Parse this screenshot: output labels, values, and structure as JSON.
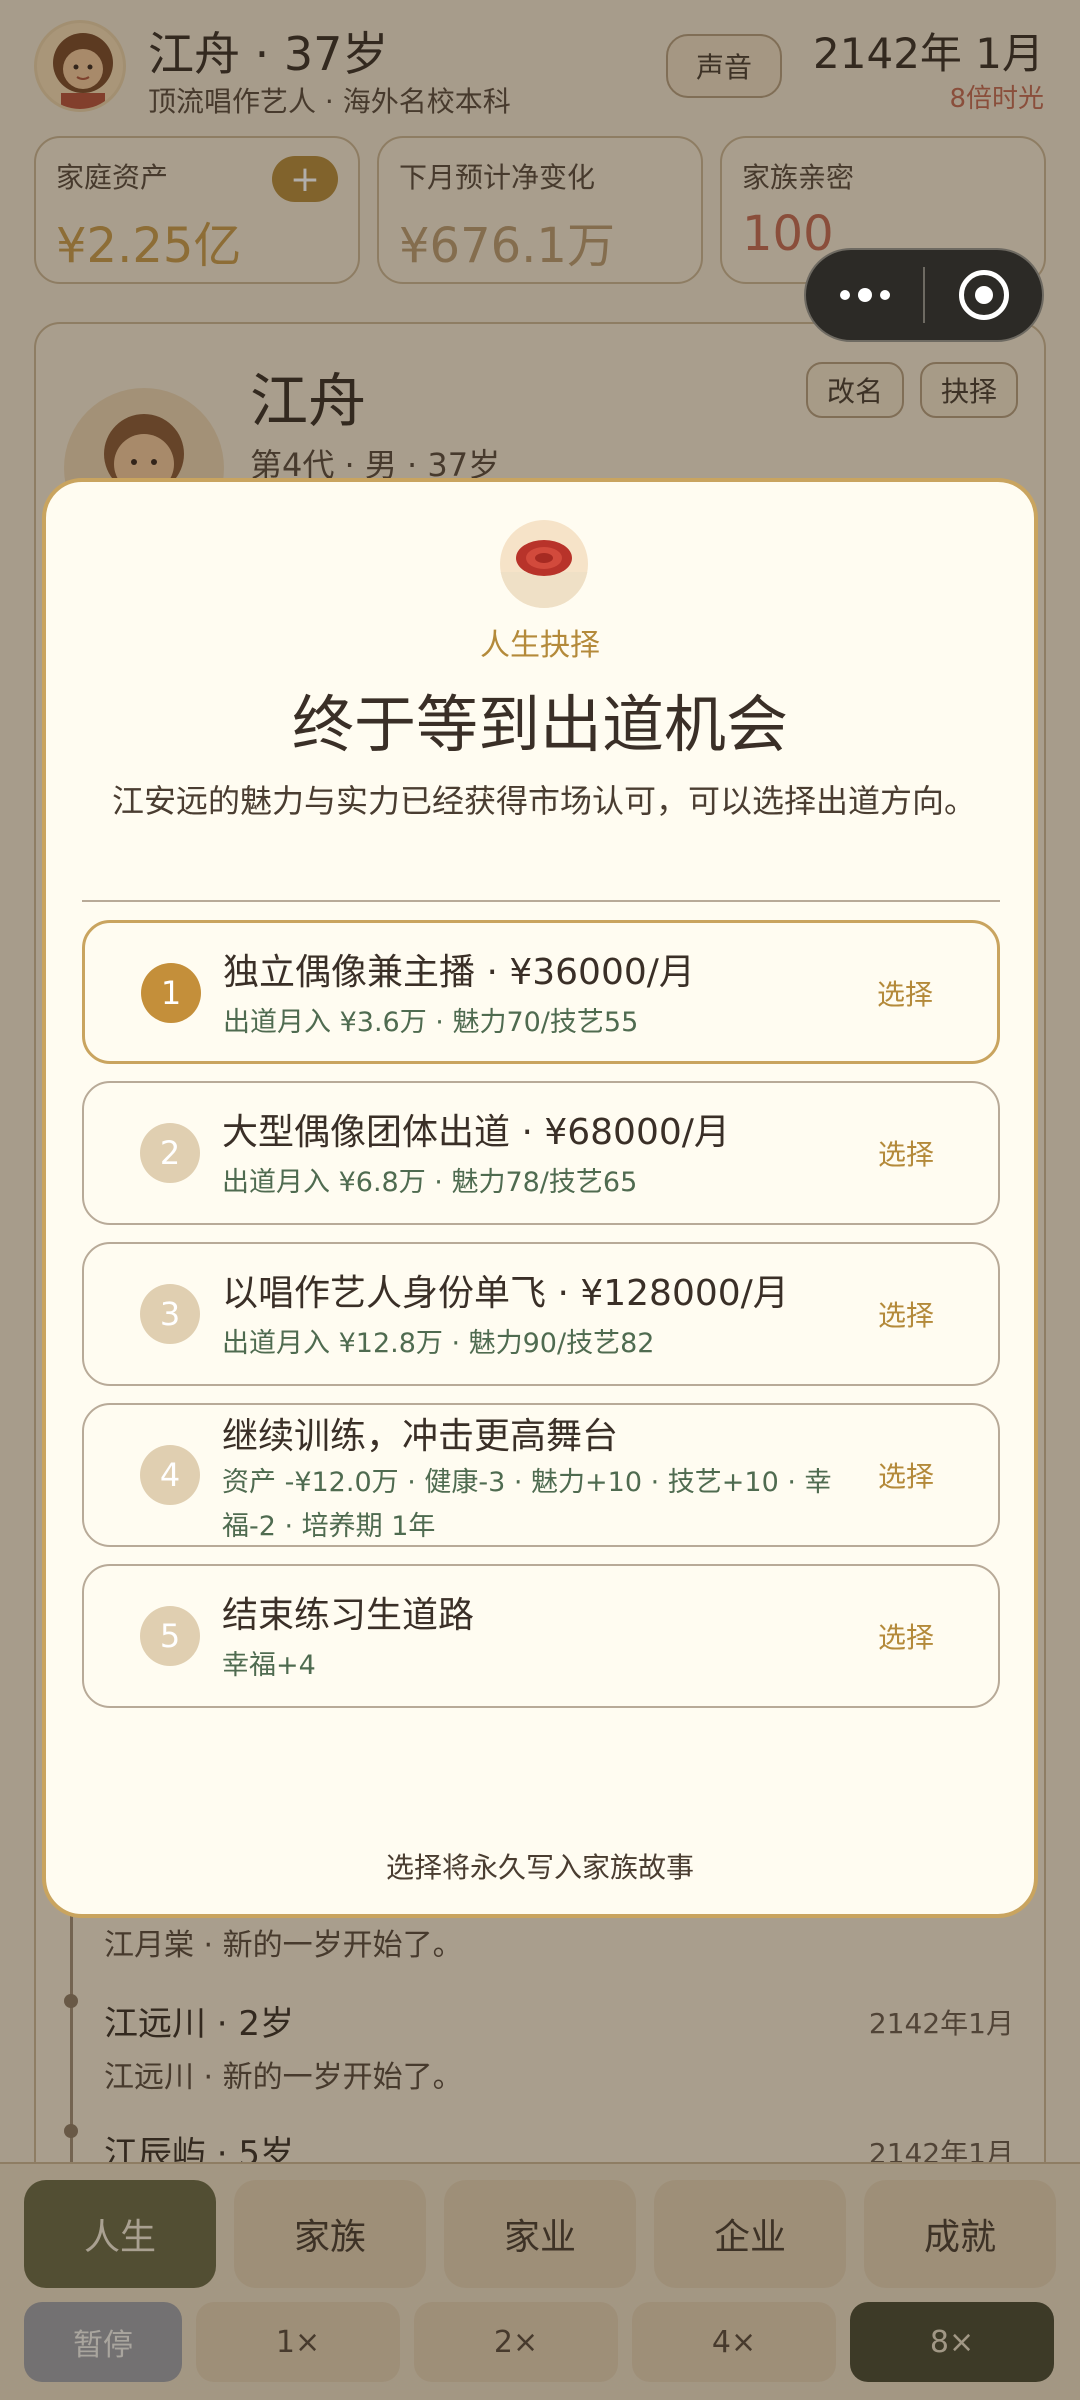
{
  "header": {
    "name_age": "江舟 · 37岁",
    "subtitle": "顶流唱作艺人 · 海外名校本科",
    "sound_label": "声音",
    "date": "2142年 1月",
    "speed_text": "8倍时光"
  },
  "stats": [
    {
      "label": "家庭资产",
      "value": "¥2.25亿",
      "color": "#c79a4a"
    },
    {
      "label": "下月预计净变化",
      "value": "¥676.1万",
      "color": "#b99a70"
    },
    {
      "label": "家族亲密",
      "value": "100",
      "color": "#c26a52"
    }
  ],
  "add_button": "+",
  "profile": {
    "name": "江舟",
    "meta": "第4代 · 男 · 37岁",
    "rename_label": "改名",
    "choose_label": "抉择"
  },
  "log": [
    {
      "title": "",
      "text": "江月棠 · 新的一岁开始了。",
      "time": ""
    },
    {
      "title": "江远川 · 2岁",
      "text": "江远川 · 新的一岁开始了。",
      "time": "2142年1月"
    },
    {
      "title": "江辰屿 · 5岁",
      "text": "",
      "time": "2142年1月"
    }
  ],
  "modal": {
    "kicker": "人生抉择",
    "title": "终于等到出道机会",
    "description": "江安远的魅力与实力已经获得市场认可，可以选择出道方向。",
    "footer": "选择将永久写入家族故事",
    "choose_label": "选择",
    "options": [
      {
        "num": "1",
        "title": "独立偶像兼主播 · ¥36000/月",
        "sub": "出道月入 ¥3.6万 · 魅力70/技艺55"
      },
      {
        "num": "2",
        "title": "大型偶像团体出道 · ¥68000/月",
        "sub": "出道月入 ¥6.8万 · 魅力78/技艺65"
      },
      {
        "num": "3",
        "title": "以唱作艺人身份单飞 · ¥128000/月",
        "sub": "出道月入 ¥12.8万 · 魅力90/技艺82"
      },
      {
        "num": "4",
        "title": "继续训练，冲击更高舞台",
        "sub": "资产 -¥12.0万 · 健康-3 · 魅力+10 · 技艺+10 · 幸福-2 · 培养期 1年"
      },
      {
        "num": "5",
        "title": "结束练习生道路",
        "sub": "幸福+4"
      }
    ]
  },
  "tabs": [
    "人生",
    "家族",
    "家业",
    "企业",
    "成就"
  ],
  "speeds": [
    "暂停",
    "1×",
    "2×",
    "4×",
    "8×"
  ]
}
